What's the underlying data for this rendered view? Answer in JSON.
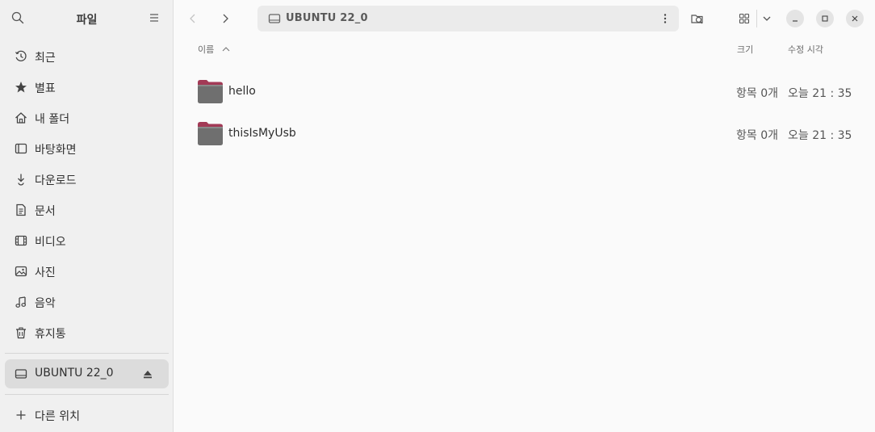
{
  "sidebar": {
    "title": "파일",
    "items": [
      {
        "label": "최근",
        "icon": "clock-icon"
      },
      {
        "label": "별표",
        "icon": "star-icon"
      },
      {
        "label": "내 폴더",
        "icon": "home-icon"
      },
      {
        "label": "바탕화면",
        "icon": "desktop-icon"
      },
      {
        "label": "다운로드",
        "icon": "download-icon"
      },
      {
        "label": "문서",
        "icon": "document-icon"
      },
      {
        "label": "비디오",
        "icon": "video-icon"
      },
      {
        "label": "사진",
        "icon": "picture-icon"
      },
      {
        "label": "음악",
        "icon": "music-icon"
      },
      {
        "label": "휴지통",
        "icon": "trash-icon"
      }
    ],
    "drive": {
      "label": "UBUNTU 22_0",
      "icon": "drive-icon"
    },
    "other_locations": {
      "label": "다른 위치",
      "icon": "plus-icon"
    }
  },
  "toolbar": {
    "path_label": "UBUNTU 22_0"
  },
  "columns": {
    "name": "이름",
    "size": "크기",
    "modified": "수정 시각"
  },
  "files": [
    {
      "name": "hello",
      "size": "항목 0개",
      "modified": "오늘 21 : 35"
    },
    {
      "name": "thisIsMyUsb",
      "size": "항목 0개",
      "modified": "오늘 21 : 35"
    }
  ],
  "colors": {
    "folder_tab": "#a23a56",
    "folder_body": "#6f6f6f",
    "sidebar_bg": "#f0f0f0",
    "selected_bg": "#dcdcdc"
  }
}
